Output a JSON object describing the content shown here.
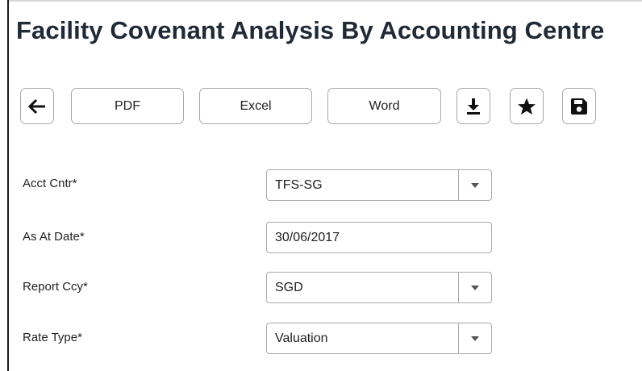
{
  "page": {
    "title": "Facility Covenant Analysis By Accounting Centre"
  },
  "toolbar": {
    "back_icon": "arrow-left-icon",
    "pdf_label": "PDF",
    "excel_label": "Excel",
    "word_label": "Word",
    "download_icon": "download-icon",
    "favorite_icon": "star-icon",
    "save_icon": "floppy-disk-icon"
  },
  "form": {
    "fields": [
      {
        "label": "Acct Cntr*",
        "value": "TFS-SG",
        "type": "select"
      },
      {
        "label": "As At Date*",
        "value": "30/06/2017",
        "type": "text"
      },
      {
        "label": "Report Ccy*",
        "value": "SGD",
        "type": "select"
      },
      {
        "label": "Rate Type*",
        "value": "Valuation",
        "type": "select"
      }
    ]
  }
}
